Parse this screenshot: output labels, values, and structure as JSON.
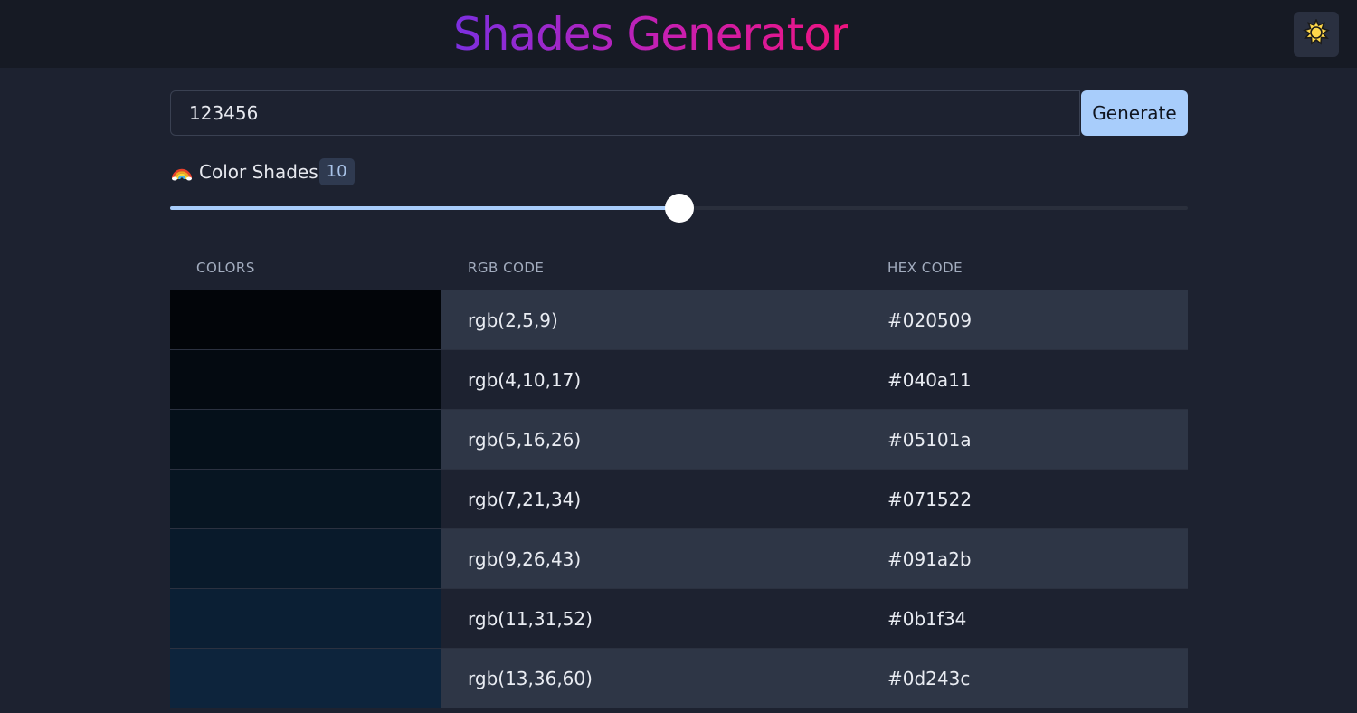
{
  "header": {
    "title": "Shades Generator",
    "theme_icon": "sun-icon",
    "title_gradient": [
      "#7c2fe0",
      "#c81fb0",
      "#ee1480"
    ]
  },
  "controls": {
    "input_value": "123456",
    "generate_label": "Generate",
    "shades_label": "Color Shades",
    "shades_icon": "rainbow-icon",
    "shades_count": "10",
    "slider_fraction": 0.5
  },
  "table": {
    "headers": [
      "COLORS",
      "RGB CODE",
      "HEX CODE"
    ],
    "rows": [
      {
        "rgb": "rgb(2,5,9)",
        "hex": "#020509"
      },
      {
        "rgb": "rgb(4,10,17)",
        "hex": "#040a11"
      },
      {
        "rgb": "rgb(5,16,26)",
        "hex": "#05101a"
      },
      {
        "rgb": "rgb(7,21,34)",
        "hex": "#071522"
      },
      {
        "rgb": "rgb(9,26,43)",
        "hex": "#091a2b"
      },
      {
        "rgb": "rgb(11,31,52)",
        "hex": "#0b1f34"
      },
      {
        "rgb": "rgb(13,36,60)",
        "hex": "#0d243c"
      }
    ]
  },
  "colors": {
    "accent": "#a8cdfb",
    "background": "#1d2230",
    "header_bg": "#161a24"
  }
}
